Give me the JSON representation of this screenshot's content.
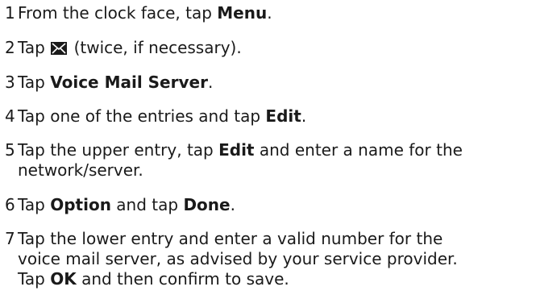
{
  "steps": [
    {
      "number": "1",
      "lines": [
        [
          "From the clock face, tap ",
          "Menu",
          "."
        ]
      ]
    },
    {
      "number": "2",
      "lines": [
        [
          "Tap ",
          "",
          " (twice, if necessary)."
        ]
      ],
      "icon": "envelope-icon"
    },
    {
      "number": "3",
      "lines": [
        [
          "Tap ",
          "Voice Mail Server",
          "."
        ]
      ]
    },
    {
      "number": "4",
      "lines": [
        [
          "Tap one of the entries and tap ",
          "Edit",
          "."
        ]
      ]
    },
    {
      "number": "5",
      "lines": [
        [
          "Tap the upper entry, tap ",
          "Edit",
          " and enter a name for the"
        ],
        [
          "network/server.",
          "",
          ""
        ]
      ]
    },
    {
      "number": "6",
      "lines": [
        [
          "Tap ",
          "Option",
          " and tap "
        ],
        [
          "",
          "Done",
          "."
        ]
      ]
    },
    {
      "number": "7",
      "lines": [
        [
          "Tap the lower entry and enter a valid number for the",
          "",
          ""
        ],
        [
          "voice mail server, as advised by your service provider.",
          "",
          ""
        ],
        [
          "Tap ",
          "OK",
          " and then confirm to save."
        ]
      ]
    }
  ]
}
